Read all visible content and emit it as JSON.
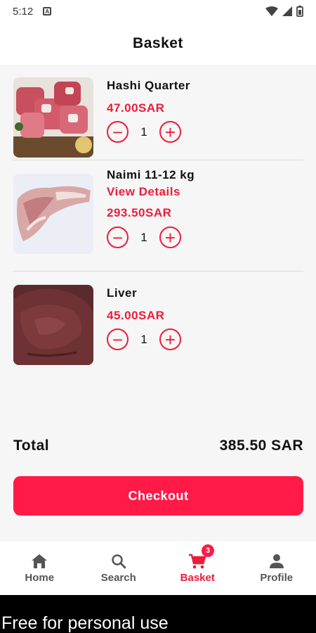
{
  "status_bar": {
    "time": "5:12"
  },
  "header": {
    "title": "Basket"
  },
  "items": [
    {
      "name": "Hashi Quarter",
      "details": "",
      "price": "47.00SAR",
      "quantity": "1"
    },
    {
      "name": "Naimi 11-12 kg",
      "details": "View Details",
      "price": "293.50SAR",
      "quantity": "1"
    },
    {
      "name": "Liver",
      "details": "",
      "price": "45.00SAR",
      "quantity": "1"
    }
  ],
  "total": {
    "label": "Total",
    "value": "385.50 SAR"
  },
  "checkout": {
    "label": "Checkout"
  },
  "nav": {
    "home": "Home",
    "search": "Search",
    "basket": "Basket",
    "basket_badge": "3",
    "profile": "Profile"
  },
  "footer": {
    "text": "Free for personal use"
  },
  "colors": {
    "accent": "#ee1c3a",
    "button": "#ff1a47"
  },
  "icons": {
    "decrement": "minus-circle-icon",
    "increment": "plus-circle-icon"
  }
}
